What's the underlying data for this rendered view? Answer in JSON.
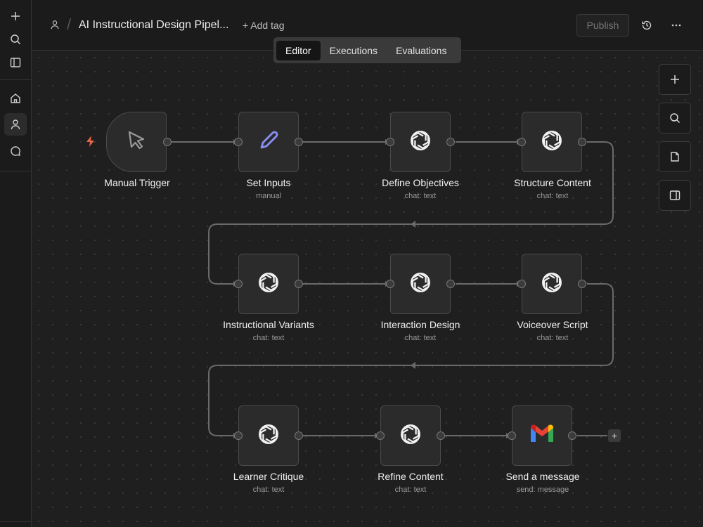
{
  "header": {
    "title": "AI Instructional Design Pipel...",
    "add_tag": "+ Add tag",
    "publish": "Publish"
  },
  "tabs": [
    {
      "label": "Editor",
      "active": true
    },
    {
      "label": "Executions",
      "active": false
    },
    {
      "label": "Evaluations",
      "active": false
    }
  ],
  "nodes": {
    "manual_trigger": {
      "label": "Manual Trigger",
      "subtitle": "",
      "icon": "cursor-icon"
    },
    "set_inputs": {
      "label": "Set Inputs",
      "subtitle": "manual",
      "icon": "pencil-icon"
    },
    "define_objectives": {
      "label": "Define Objectives",
      "subtitle": "chat: text",
      "icon": "openai-icon"
    },
    "structure_content": {
      "label": "Structure Content",
      "subtitle": "chat: text",
      "icon": "openai-icon"
    },
    "instructional_variants": {
      "label": "Instructional Variants",
      "subtitle": "chat: text",
      "icon": "openai-icon"
    },
    "interaction_design": {
      "label": "Interaction Design",
      "subtitle": "chat: text",
      "icon": "openai-icon"
    },
    "voiceover_script": {
      "label": "Voiceover Script",
      "subtitle": "chat: text",
      "icon": "openai-icon"
    },
    "learner_critique": {
      "label": "Learner Critique",
      "subtitle": "chat: text",
      "icon": "openai-icon"
    },
    "refine_content": {
      "label": "Refine Content",
      "subtitle": "chat: text",
      "icon": "openai-icon"
    },
    "send_message": {
      "label": "Send a message",
      "subtitle": "send: message",
      "icon": "gmail-icon"
    }
  },
  "add_node_symbol": "+",
  "colors": {
    "trigger_bolt": "#e8654b",
    "pencil": "#8b8ef5",
    "canvas_bg": "#1f1f1f",
    "node_bg": "#2b2b2b"
  }
}
